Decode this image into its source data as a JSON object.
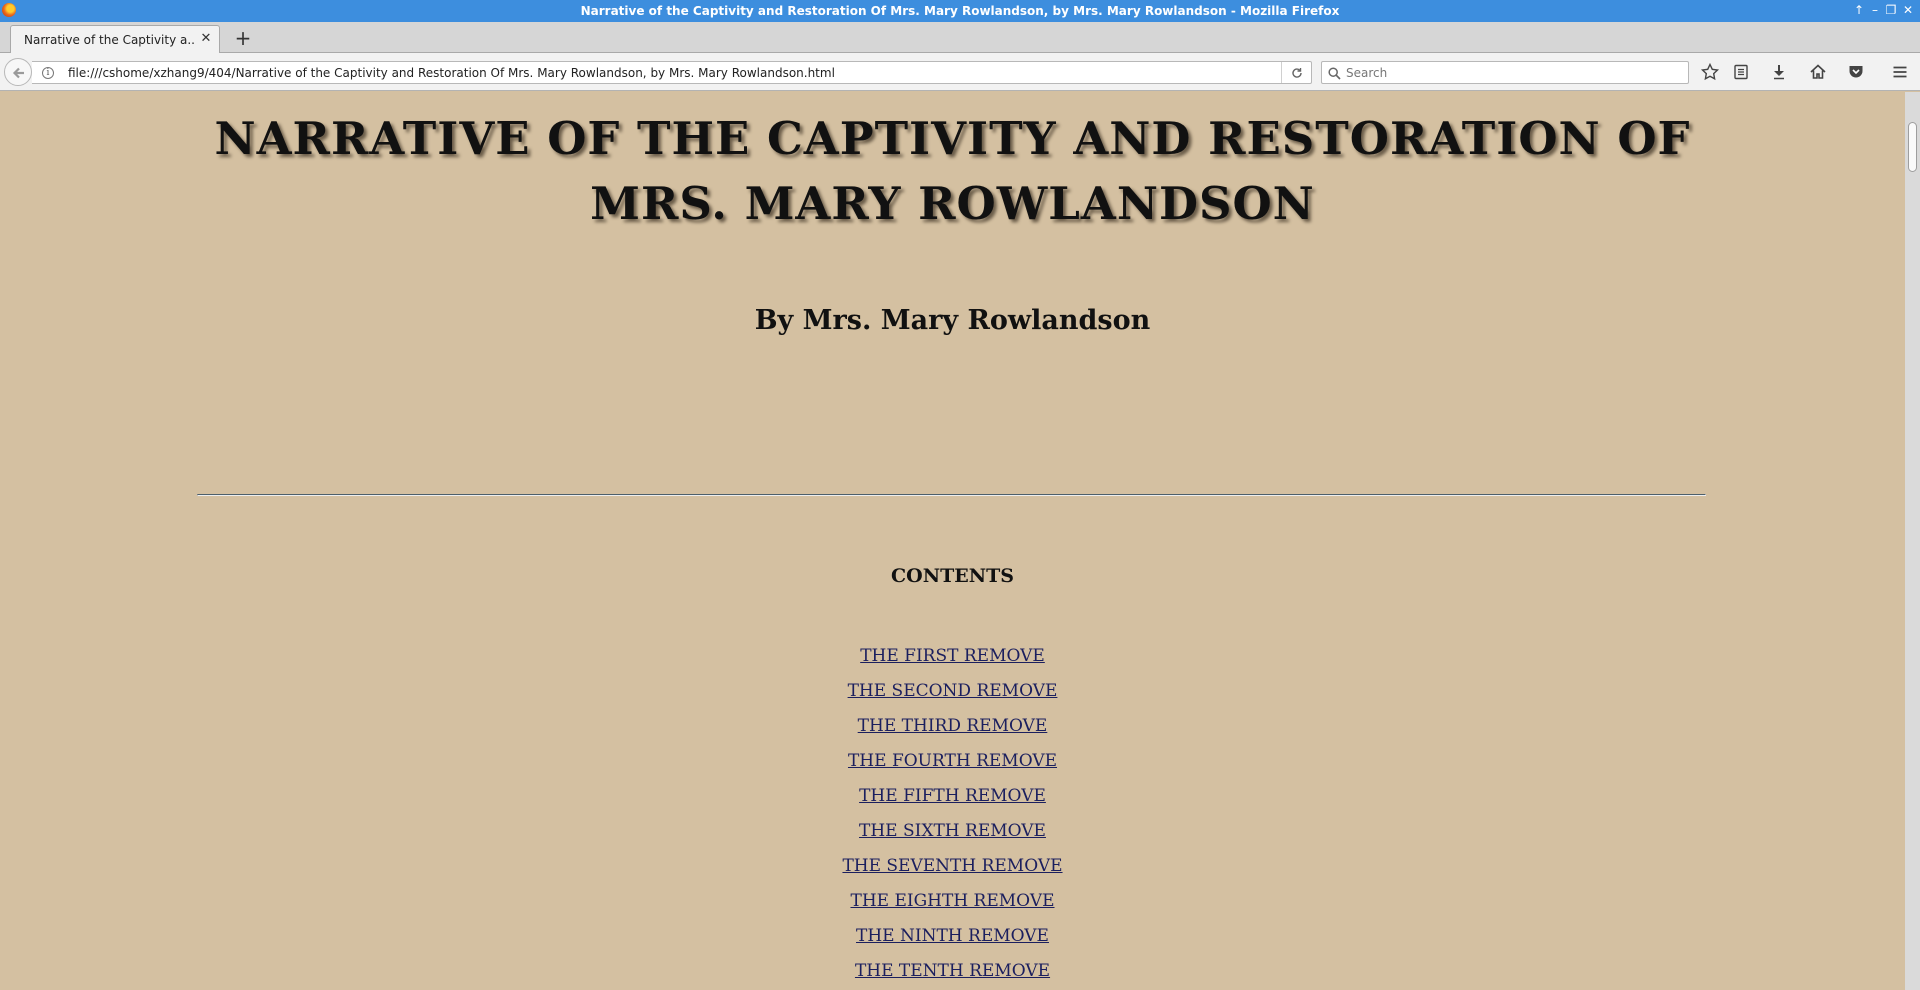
{
  "window": {
    "title": "Narrative of the Captivity and Restoration Of Mrs. Mary Rowlandson, by Mrs. Mary Rowlandson - Mozilla Firefox",
    "controls": {
      "up": "↑",
      "minimize": "–",
      "restore": "❐",
      "close": "✕"
    }
  },
  "tabs": [
    {
      "label": "Narrative of the Captivity a...",
      "close": "✕"
    }
  ],
  "new_tab": "+",
  "navbar": {
    "url": "file:///cshome/xzhang9/404/Narrative of the Captivity and Restoration Of Mrs. Mary Rowlandson, by Mrs. Mary Rowlandson.html",
    "info_icon": "i",
    "search_placeholder": "Search",
    "toolbar_icons": [
      "bookmark-star-icon",
      "reading-list-icon",
      "download-icon",
      "home-icon",
      "pocket-icon",
      "hamburger-menu-icon"
    ]
  },
  "page": {
    "title": "NARRATIVE OF THE CAPTIVITY AND RESTORATION OF MRS. MARY ROWLANDSON",
    "author": "By Mrs. Mary Rowlandson",
    "contents_heading": "CONTENTS",
    "toc": [
      "THE FIRST REMOVE",
      "THE SECOND REMOVE",
      "THE THIRD REMOVE",
      "THE FOURTH REMOVE",
      "THE FIFTH REMOVE",
      "THE SIXTH REMOVE",
      "THE SEVENTH REMOVE",
      "THE EIGHTH REMOVE",
      "THE NINTH REMOVE",
      "THE TENTH REMOVE"
    ]
  },
  "colors": {
    "page_background": "#d4c0a1",
    "titlebar": "#3d8ede",
    "link": "#1b1f5e"
  }
}
